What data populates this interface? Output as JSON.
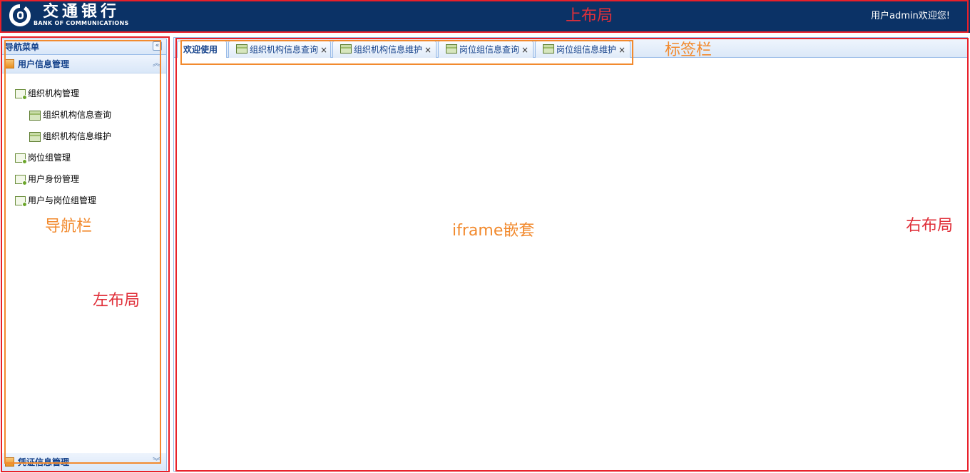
{
  "header": {
    "logo_cn": "交通银行",
    "logo_en": "BANK OF COMMUNICATIONS",
    "welcome": "用户admin欢迎您!",
    "bg_color": "#0b3266"
  },
  "nav": {
    "title": "导航菜单",
    "collapse_icon": "double-chevron-left-icon",
    "sections": [
      {
        "label": "用户信息管理",
        "expanded": true,
        "items": [
          {
            "label": "组织机构管理",
            "icon": "folder-icon",
            "level": 1
          },
          {
            "label": "组织机构信息查询",
            "icon": "page-icon",
            "level": 2
          },
          {
            "label": "组织机构信息维护",
            "icon": "page-icon",
            "level": 2
          },
          {
            "label": "岗位组管理",
            "icon": "folder-icon",
            "level": 1
          },
          {
            "label": "用户身份管理",
            "icon": "folder-icon",
            "level": 1
          },
          {
            "label": "用户与岗位组管理",
            "icon": "folder-icon",
            "level": 1
          }
        ]
      },
      {
        "label": "凭证信息管理",
        "expanded": false,
        "items": []
      }
    ]
  },
  "tabs": [
    {
      "label": "欢迎使用",
      "active": true,
      "closable": false
    },
    {
      "label": "组织机构信息查询",
      "active": false,
      "closable": true
    },
    {
      "label": "组织机构信息维护",
      "active": false,
      "closable": true
    },
    {
      "label": "岗位组信息查询",
      "active": false,
      "closable": true
    },
    {
      "label": "岗位组信息维护",
      "active": false,
      "closable": true
    }
  ],
  "close_glyph": "×",
  "annotations": {
    "top_layout": "上布局",
    "tab_bar": "标签栏",
    "nav_bar": "导航栏",
    "left_layout": "左布局",
    "iframe": "iframe嵌套",
    "right_layout": "右布局"
  },
  "colors": {
    "annotation_red": "#e8202a",
    "annotation_orange": "#f28a2e",
    "accent_blue": "#15428b"
  }
}
